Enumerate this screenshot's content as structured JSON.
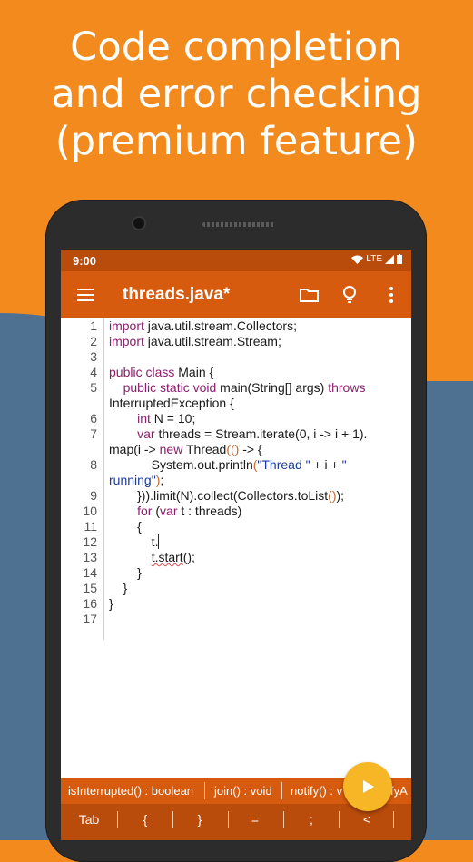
{
  "headline": {
    "line1": "Code completion",
    "line2": "and error checking",
    "line3": "(premium feature)"
  },
  "colors": {
    "background": "#f28a1d",
    "background_blue": "#4f7191",
    "app_bar": "#d75b0e",
    "status_bar": "#b94b0b",
    "fab": "#f7b626"
  },
  "status_bar": {
    "time": "9:00",
    "network": "LTE"
  },
  "toolbar": {
    "title": "threads.java*",
    "menu_icon": "hamburger-menu-icon",
    "folder_icon": "folder-icon",
    "bulb_icon": "lightbulb-icon",
    "more_icon": "more-vertical-icon"
  },
  "editor": {
    "line_numbers": [
      "1",
      "2",
      "3",
      "4",
      "5",
      "",
      "6",
      "7",
      "",
      "8",
      "",
      "9",
      "10",
      "11",
      "12",
      "13",
      "14",
      "15",
      "16",
      "17"
    ]
  },
  "suggestions": [
    "isInterrupted() : boolean",
    "join() : void",
    "notify() : v",
    "notifyA"
  ],
  "keys": [
    "Tab",
    "{",
    "}",
    "=",
    ";",
    "<"
  ],
  "fab": {
    "icon": "play-icon"
  }
}
